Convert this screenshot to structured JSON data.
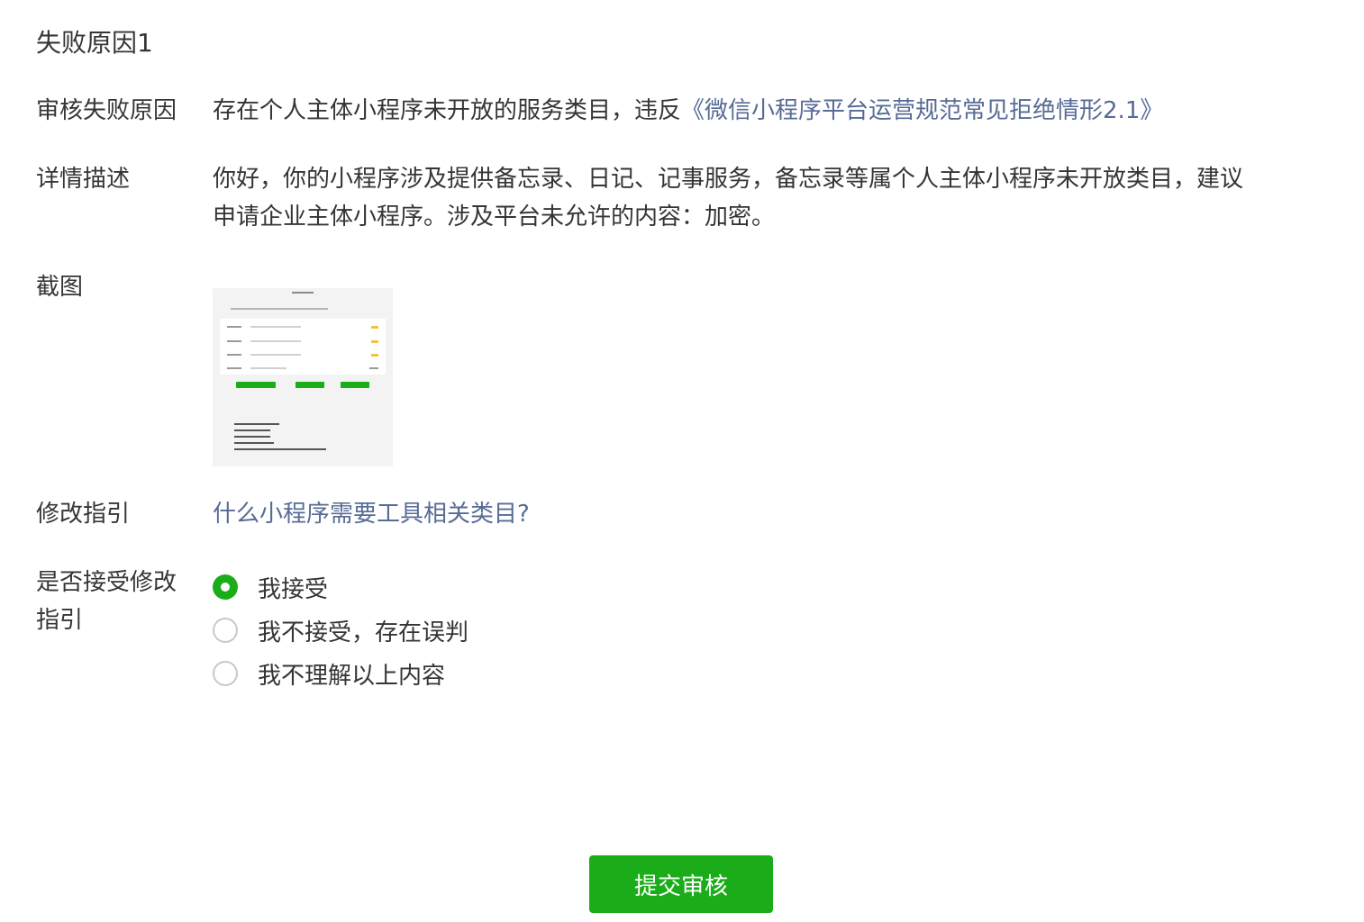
{
  "section_title": "失败原因1",
  "reason": {
    "label": "审核失败原因",
    "text": "存在个人主体小程序未开放的服务类目，违反",
    "link": "《微信小程序平台运营规范常见拒绝情形2.1》"
  },
  "detail": {
    "label": "详情描述",
    "line1": "你好，你的小程序涉及提供备忘录、日记、记事服务，备忘录等属个人主体小程序未开放类目，建议",
    "line2": "申请企业主体小程序。涉及平台未允许的内容：加密。"
  },
  "screenshot": {
    "label": "截图"
  },
  "guide": {
    "label": "修改指引",
    "link": "什么小程序需要工具相关类目?"
  },
  "accept": {
    "label_line1": "是否接受修改",
    "label_line2": "指引",
    "options": [
      {
        "label": "我接受",
        "selected": true
      },
      {
        "label": "我不接受，存在误判",
        "selected": false
      },
      {
        "label": "我不理解以上内容",
        "selected": false
      }
    ]
  },
  "submit_label": "提交审核",
  "colors": {
    "accent_green": "#1aad19",
    "link_blue": "#576b95",
    "text": "#353535"
  }
}
